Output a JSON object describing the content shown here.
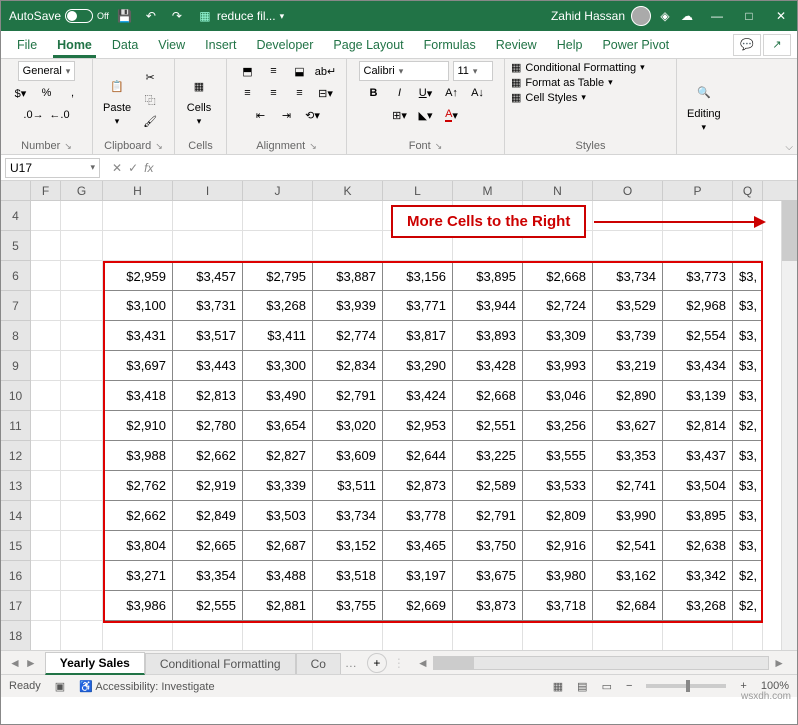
{
  "titlebar": {
    "autosave_label": "AutoSave",
    "autosave_state": "Off",
    "filename": "reduce fil...",
    "user_name": "Zahid Hassan"
  },
  "tabs": {
    "file": "File",
    "home": "Home",
    "data": "Data",
    "view": "View",
    "insert": "Insert",
    "developer": "Developer",
    "page_layout": "Page Layout",
    "formulas": "Formulas",
    "review": "Review",
    "help": "Help",
    "power_pivot": "Power Pivot"
  },
  "ribbon": {
    "number": {
      "format": "General",
      "label": "Number"
    },
    "clipboard": {
      "paste": "Paste",
      "label": "Clipboard"
    },
    "cells": {
      "btn": "Cells",
      "label": "Cells"
    },
    "alignment": {
      "label": "Alignment"
    },
    "font": {
      "name": "Calibri",
      "size": "11",
      "label": "Font"
    },
    "styles": {
      "cond": "Conditional Formatting",
      "table": "Format as Table",
      "cell": "Cell Styles",
      "label": "Styles"
    },
    "editing": {
      "label": "Editing"
    }
  },
  "formula_bar": {
    "cell_ref": "U17",
    "formula": ""
  },
  "callout": {
    "text": "More Cells to the Right"
  },
  "columns": [
    "F",
    "G",
    "H",
    "I",
    "J",
    "K",
    "L",
    "M",
    "N",
    "O",
    "P",
    "Q"
  ],
  "row_numbers": [
    4,
    5,
    6,
    7,
    8,
    9,
    10,
    11,
    12,
    13,
    14,
    15,
    16,
    17,
    18
  ],
  "grid": {
    "r6": {
      "H": "$2,959",
      "I": "$3,457",
      "J": "$2,795",
      "K": "$3,887",
      "L": "$3,156",
      "M": "$3,895",
      "N": "$2,668",
      "O": "$3,734",
      "P": "$3,773",
      "Q": "$3,"
    },
    "r7": {
      "H": "$3,100",
      "I": "$3,731",
      "J": "$3,268",
      "K": "$3,939",
      "L": "$3,771",
      "M": "$3,944",
      "N": "$2,724",
      "O": "$3,529",
      "P": "$2,968",
      "Q": "$3,"
    },
    "r8": {
      "H": "$3,431",
      "I": "$3,517",
      "J": "$3,411",
      "K": "$2,774",
      "L": "$3,817",
      "M": "$3,893",
      "N": "$3,309",
      "O": "$3,739",
      "P": "$2,554",
      "Q": "$3,"
    },
    "r9": {
      "H": "$3,697",
      "I": "$3,443",
      "J": "$3,300",
      "K": "$2,834",
      "L": "$3,290",
      "M": "$3,428",
      "N": "$3,993",
      "O": "$3,219",
      "P": "$3,434",
      "Q": "$3,"
    },
    "r10": {
      "H": "$3,418",
      "I": "$2,813",
      "J": "$3,490",
      "K": "$2,791",
      "L": "$3,424",
      "M": "$2,668",
      "N": "$3,046",
      "O": "$2,890",
      "P": "$3,139",
      "Q": "$3,"
    },
    "r11": {
      "H": "$2,910",
      "I": "$2,780",
      "J": "$3,654",
      "K": "$3,020",
      "L": "$2,953",
      "M": "$2,551",
      "N": "$3,256",
      "O": "$3,627",
      "P": "$2,814",
      "Q": "$2,"
    },
    "r12": {
      "H": "$3,988",
      "I": "$2,662",
      "J": "$2,827",
      "K": "$3,609",
      "L": "$2,644",
      "M": "$3,225",
      "N": "$3,555",
      "O": "$3,353",
      "P": "$3,437",
      "Q": "$3,"
    },
    "r13": {
      "H": "$2,762",
      "I": "$2,919",
      "J": "$3,339",
      "K": "$3,511",
      "L": "$2,873",
      "M": "$2,589",
      "N": "$3,533",
      "O": "$2,741",
      "P": "$3,504",
      "Q": "$3,"
    },
    "r14": {
      "H": "$2,662",
      "I": "$2,849",
      "J": "$3,503",
      "K": "$3,734",
      "L": "$3,778",
      "M": "$2,791",
      "N": "$2,809",
      "O": "$3,990",
      "P": "$3,895",
      "Q": "$3,"
    },
    "r15": {
      "H": "$3,804",
      "I": "$2,665",
      "J": "$2,687",
      "K": "$3,152",
      "L": "$3,465",
      "M": "$3,750",
      "N": "$2,916",
      "O": "$2,541",
      "P": "$2,638",
      "Q": "$3,"
    },
    "r16": {
      "H": "$3,271",
      "I": "$3,354",
      "J": "$3,488",
      "K": "$3,518",
      "L": "$3,197",
      "M": "$3,675",
      "N": "$3,980",
      "O": "$3,162",
      "P": "$3,342",
      "Q": "$2,"
    },
    "r17": {
      "H": "$3,986",
      "I": "$2,555",
      "J": "$2,881",
      "K": "$3,755",
      "L": "$2,669",
      "M": "$3,873",
      "N": "$3,718",
      "O": "$2,684",
      "P": "$3,268",
      "Q": "$2,"
    }
  },
  "sheets": {
    "active": "Yearly Sales",
    "tab2": "Conditional Formatting",
    "tab3": "Co"
  },
  "status": {
    "ready": "Ready",
    "accessibility": "Accessibility: Investigate",
    "zoom": "100%"
  },
  "watermark": "wsxdh.com"
}
